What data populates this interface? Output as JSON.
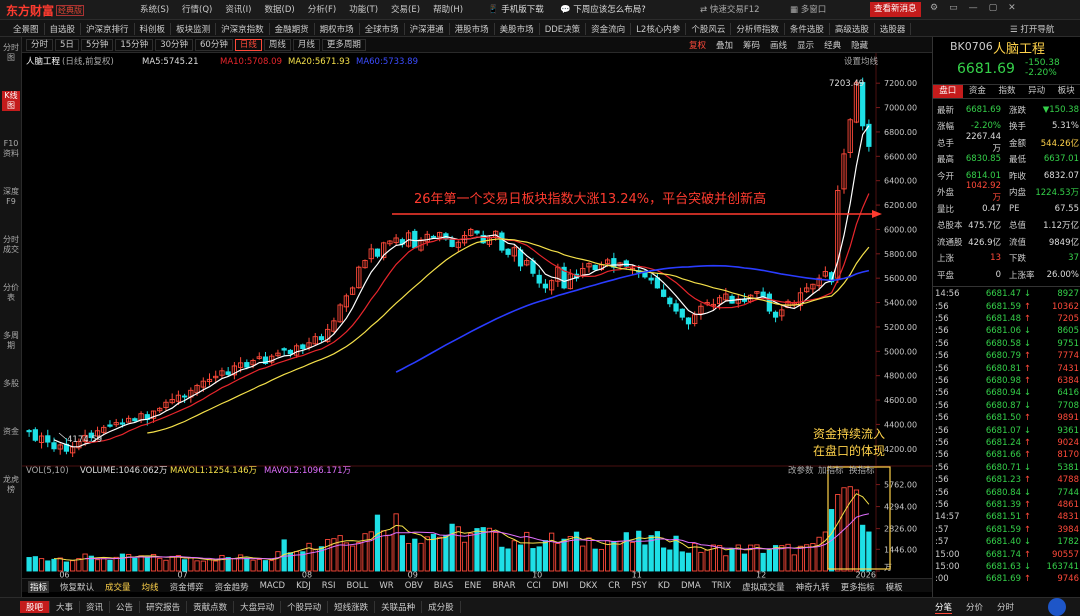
{
  "titlebar": {
    "brand": "东方财富",
    "edition": "经典版",
    "menus": [
      "系统(S)",
      "行情(Q)",
      "资讯(I)",
      "数据(D)",
      "分析(F)",
      "功能(T)",
      "交易(E)",
      "帮助(H)"
    ],
    "mobile_download": "手机版下载",
    "hot_topic": "下周应该怎么布局?",
    "quick_trade": "快速交易F12",
    "multi_window": "多窗口",
    "new_message": "查看新消息",
    "window_buttons": [
      "⚙",
      "▭",
      "—",
      "▢",
      "✕"
    ]
  },
  "navbar": {
    "items": [
      "全景图",
      "自选股",
      "沪深京排行",
      "科创板",
      "板块监测",
      "沪深京指数",
      "金融期货",
      "期权市场",
      "全球市场",
      "沪深港通",
      "港股市场",
      "美股市场",
      "DDE决策",
      "资金流向",
      "L2核心内参",
      "个股风云",
      "分析师指数",
      "条件选股",
      "高级选股",
      "选股器"
    ],
    "open_nav": "打开导航"
  },
  "left_strip": [
    {
      "label": "分时图",
      "active": false
    },
    {
      "label": "K线图",
      "active": true
    },
    {
      "label": "F10资料",
      "active": false
    },
    {
      "label": "深度F9",
      "active": false
    },
    {
      "label": "分时成交",
      "active": false
    },
    {
      "label": "分价表",
      "active": false
    },
    {
      "label": "多周期",
      "active": false
    },
    {
      "label": "多股",
      "active": false
    },
    {
      "label": "资金",
      "active": false
    },
    {
      "label": "龙虎榜",
      "active": false
    }
  ],
  "periods": {
    "items": [
      "分时",
      "5日",
      "5分钟",
      "15分钟",
      "30分钟",
      "60分钟",
      "日线",
      "周线",
      "月线",
      "更多周期"
    ],
    "selected": "日线",
    "tools": [
      "复权",
      "叠加",
      "筹码",
      "画线",
      "显示",
      "经典",
      "隐藏"
    ]
  },
  "chart": {
    "header": {
      "name": "人脑工程",
      "desc": "(日线,前复权)",
      "ma5": "MA5:5745.21",
      "ma10": "MA10:5708.09",
      "ma20": "MA20:5671.93",
      "ma60": "MA60:5733.89",
      "settings": "设置均线"
    },
    "annotation_main": "26年第一个交易日板块指数大涨13.24%，平台突破并创新高",
    "annotation_vol_1": "资金持续流入",
    "annotation_vol_2": "在盘口的体现",
    "high_label": "7203.49",
    "low_label": "4174.59",
    "vol_header": {
      "name": "VOL(5,10)",
      "volume": "VOLUME:1046.062万",
      "mavol1": "MAVOL1:1254.146万",
      "mavol2": "MAVOL2:1096.171万"
    },
    "vol_tools": [
      "改参数",
      "加指标",
      "换指标"
    ],
    "x_labels": [
      "06",
      "07",
      "08",
      "09",
      "10",
      "11",
      "12",
      "2026"
    ],
    "y_ticks": [
      "7200.00",
      "7000.00",
      "6800.00",
      "6600.00",
      "6400.00",
      "6200.00",
      "6000.00",
      "5800.00",
      "5600.00",
      "5400.00",
      "5200.00",
      "5000.00",
      "4800.00",
      "4600.00",
      "4400.00",
      "4200.00"
    ],
    "vol_ticks": [
      "5762.00",
      "4294.00",
      "2826.00",
      "1446.00",
      "万"
    ],
    "colors": {
      "up": "#ff4a3a",
      "down": "#1ee0e6",
      "ma5": "#ffffff",
      "ma10": "#e8262c",
      "ma20": "#f4e04a",
      "ma60": "#2a3cff"
    }
  },
  "chart_data": {
    "type": "candlestick",
    "title": "人脑工程 (日线,前复权)",
    "y_range": [
      4174.59,
      7203.49
    ],
    "months": [
      "06",
      "07",
      "08",
      "09",
      "10",
      "11",
      "12",
      "2026"
    ],
    "series": [
      {
        "name": "K线(收盘价)",
        "closes": [
          4340,
          4270,
          4305,
          4255,
          4200,
          4232,
          4180,
          4215,
          4260,
          4310,
          4292,
          4348,
          4376,
          4385,
          4415,
          4402,
          4450,
          4430,
          4488,
          4440,
          4510,
          4532,
          4582,
          4605,
          4640,
          4625,
          4680,
          4720,
          4755,
          4770,
          4795,
          4840,
          4810,
          4880,
          4905,
          4870,
          4925,
          4955,
          4900,
          4960,
          4985,
          5010,
          4980,
          5045,
          5022,
          5070,
          5120,
          5095,
          5180,
          5250,
          5380,
          5455,
          5520,
          5690,
          5745,
          5840,
          5780,
          5890,
          5905,
          5930,
          5880,
          5972,
          5850,
          5915,
          5960,
          5935,
          5975,
          5920,
          5860,
          5895,
          5950,
          6000,
          5970,
          5890,
          5930,
          5985,
          5830,
          5795,
          5850,
          5700,
          5745,
          5640,
          5560,
          5520,
          5580,
          5690,
          5520,
          5635,
          5600,
          5680,
          5720,
          5670,
          5710,
          5750,
          5690,
          5725,
          5700,
          5680,
          5650,
          5610,
          5585,
          5520,
          5450,
          5390,
          5330,
          5280,
          5225,
          5300,
          5370,
          5400,
          5385,
          5440,
          5470,
          5395,
          5430,
          5410,
          5460,
          5490,
          5450,
          5330,
          5280,
          5340,
          5410,
          5395,
          5480,
          5520,
          5550,
          5600,
          5655,
          5570,
          6320,
          6620,
          6900,
          7203,
          6850,
          6681
        ]
      }
    ],
    "ma": {
      "MA5": 5745.21,
      "MA10": 5708.09,
      "MA20": 5671.93,
      "MA60": 5733.89
    },
    "volume": {
      "unit": "万",
      "VOLUME": 1046.062,
      "MAVOL1": 1254.146,
      "MAVOL2": 1096.171,
      "y_range": [
        0,
        5762
      ],
      "recent_bars": [
        2250,
        2600,
        4100,
        5100,
        5550,
        5620,
        5400,
        3050,
        2600
      ]
    }
  },
  "quote_panel": {
    "code": "BK0706",
    "name": "人脑工程",
    "price": "6681.69",
    "change": "-150.38",
    "change_pct": "-2.20%",
    "tabs": [
      "盘口",
      "资金",
      "指数",
      "异动",
      "板块"
    ],
    "rows": [
      {
        "l1": "最新",
        "v1": "6681.69",
        "c1": "dn",
        "l2": "涨跌",
        "v2": "▼150.38",
        "c2": "dn"
      },
      {
        "l1": "涨幅",
        "v1": "-2.20%",
        "c1": "dn",
        "l2": "换手",
        "v2": "5.31%",
        "c2": "wh"
      },
      {
        "l1": "总手",
        "v1": "2267.44万",
        "c1": "wh",
        "l2": "金额",
        "v2": "544.26亿",
        "c2": "ye"
      },
      {
        "l1": "最高",
        "v1": "6830.85",
        "c1": "dn",
        "l2": "最低",
        "v2": "6637.01",
        "c2": "dn"
      },
      {
        "l1": "今开",
        "v1": "6814.01",
        "c1": "dn",
        "l2": "昨收",
        "v2": "6832.07",
        "c2": "wh"
      },
      {
        "l1": "外盘",
        "v1": "1042.92万",
        "c1": "up",
        "l2": "内盘",
        "v2": "1224.53万",
        "c2": "dn"
      },
      {
        "l1": "量比",
        "v1": "0.47",
        "c1": "wh",
        "l2": "PE",
        "v2": "67.55",
        "c2": "wh"
      },
      {
        "l1": "总股本",
        "v1": "475.7亿",
        "c1": "wh",
        "l2": "总值",
        "v2": "1.12万亿",
        "c2": "wh"
      },
      {
        "l1": "流通股",
        "v1": "426.9亿",
        "c1": "wh",
        "l2": "流值",
        "v2": "9849亿",
        "c2": "wh"
      },
      {
        "l1": "上涨",
        "v1": "13",
        "c1": "up",
        "l2": "下跌",
        "v2": "37",
        "c2": "dn"
      },
      {
        "l1": "平盘",
        "v1": "0",
        "c1": "wh",
        "l2": "上涨率",
        "v2": "26.00%",
        "c2": "wh"
      }
    ],
    "ticks": [
      {
        "t": "14:56",
        "p": "6681.47",
        "a": "↓",
        "v": "8927",
        "c": "dn"
      },
      {
        "t": ":56",
        "p": "6681.59",
        "a": "↑",
        "v": "10362",
        "c": "up"
      },
      {
        "t": ":56",
        "p": "6681.48",
        "a": "↑",
        "v": "7205",
        "c": "up"
      },
      {
        "t": ":56",
        "p": "6681.06",
        "a": "↓",
        "v": "8605",
        "c": "dn"
      },
      {
        "t": ":56",
        "p": "6680.58",
        "a": "↓",
        "v": "9751",
        "c": "dn"
      },
      {
        "t": ":56",
        "p": "6680.79",
        "a": "↑",
        "v": "7774",
        "c": "up"
      },
      {
        "t": ":56",
        "p": "6680.81",
        "a": "↑",
        "v": "7431",
        "c": "up"
      },
      {
        "t": ":56",
        "p": "6680.98",
        "a": "↑",
        "v": "6384",
        "c": "up"
      },
      {
        "t": ":56",
        "p": "6680.94",
        "a": "↓",
        "v": "6416",
        "c": "dn"
      },
      {
        "t": ":56",
        "p": "6680.87",
        "a": "↓",
        "v": "7708",
        "c": "dn"
      },
      {
        "t": ":56",
        "p": "6681.50",
        "a": "↑",
        "v": "9891",
        "c": "up"
      },
      {
        "t": ":56",
        "p": "6681.07",
        "a": "↓",
        "v": "9361",
        "c": "dn"
      },
      {
        "t": ":56",
        "p": "6681.24",
        "a": "↑",
        "v": "9024",
        "c": "up"
      },
      {
        "t": ":56",
        "p": "6681.66",
        "a": "↑",
        "v": "8170",
        "c": "up"
      },
      {
        "t": ":56",
        "p": "6680.71",
        "a": "↓",
        "v": "5381",
        "c": "dn"
      },
      {
        "t": ":56",
        "p": "6681.23",
        "a": "↑",
        "v": "4788",
        "c": "up"
      },
      {
        "t": ":56",
        "p": "6680.84",
        "a": "↓",
        "v": "7744",
        "c": "dn"
      },
      {
        "t": ":56",
        "p": "6681.39",
        "a": "↑",
        "v": "4861",
        "c": "up"
      },
      {
        "t": "14:57",
        "p": "6681.51",
        "a": "↑",
        "v": "4831",
        "c": "up"
      },
      {
        "t": ":57",
        "p": "6681.59",
        "a": "↑",
        "v": "3984",
        "c": "up"
      },
      {
        "t": ":57",
        "p": "6681.40",
        "a": "↓",
        "v": "1782",
        "c": "dn"
      },
      {
        "t": "15:00",
        "p": "6681.74",
        "a": "↑",
        "v": "90557",
        "c": "up"
      },
      {
        "t": "15:00",
        "p": "6681.63",
        "a": "↓",
        "v": "163741",
        "c": "dn"
      },
      {
        "t": ":00",
        "p": "6681.69",
        "a": "↑",
        "v": "9746",
        "c": "up"
      }
    ]
  },
  "indicator_tabs": [
    "指标",
    "恢复默认",
    "成交量",
    "均线",
    "资金博弈",
    "资金趋势",
    "MACD",
    "KDJ",
    "RSI",
    "BOLL",
    "WR",
    "OBV",
    "BIAS",
    "ENE",
    "BRAR",
    "CCI",
    "DMI",
    "DKX",
    "CR",
    "PSY",
    "KD",
    "DMA",
    "TRIX",
    "虚拟成交量",
    "神奇九转",
    "更多指标",
    "模板"
  ],
  "bottom_tabs": [
    "股吧",
    "大事",
    "资讯",
    "公告",
    "研究报告",
    "贡献点数",
    "大盘异动",
    "个股异动",
    "短线涨跌",
    "关联品种",
    "成分股"
  ],
  "bottom_right": [
    "分笔",
    "分价",
    "分时"
  ]
}
